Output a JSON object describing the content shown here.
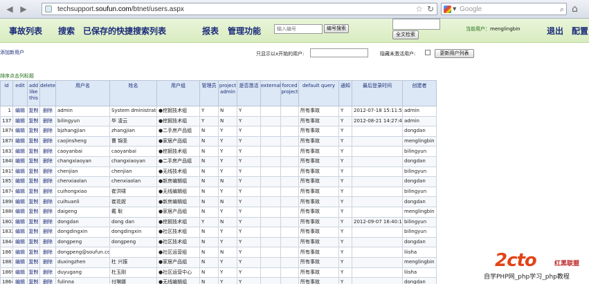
{
  "browser": {
    "url_prefix": "techsupport.",
    "url_host": "soufun.com",
    "url_path": "/btnet/users.aspx",
    "search_placeholder": "Google"
  },
  "header": {
    "menu": [
      "事故列表",
      "搜索",
      "已保存的快捷搜索列表",
      "报表",
      "管理功能"
    ],
    "search_placeholder": "输入编号",
    "search_button": "编号搜索",
    "fulltext_button": "全文检索",
    "current_user_label": "当前用户：",
    "current_user": "menglingbin",
    "logout": "退出",
    "settings": "配置"
  },
  "toolbar": {
    "add_user": "添加新用户",
    "filter_label": "只显示以x开始的用户:",
    "hide_inactive_label": "隐藏未激活用户:",
    "refresh_button": "更新用户列表",
    "sort_hint": "排序点击列标题"
  },
  "table": {
    "headers": [
      "id",
      "edit",
      "add like this",
      "delete",
      "用户名",
      "姓名",
      "用户组",
      "管理员",
      "project admin",
      "是否激活",
      "external",
      "forced project",
      "default query",
      "通知",
      "最后登录时间",
      "创建者"
    ],
    "action_labels": {
      "edit": "编辑",
      "copy": "复制",
      "delete": "删除"
    },
    "rows": [
      {
        "id": "1",
        "username": "admin",
        "name": "System dministrator",
        "group": "●挖掘技术组",
        "admin": "Y",
        "pa": "N",
        "active": "Y",
        "ext": "N",
        "query": "所有事故",
        "notify": "Y",
        "last": "2012-07-18 15:11:54",
        "creator": "admin"
      },
      {
        "id": "137",
        "username": "bilingyun",
        "name": "毕 凌云",
        "group": "●挖掘技术组",
        "admin": "Y",
        "pa": "N",
        "active": "Y",
        "ext": "N",
        "query": "所有事故",
        "notify": "Y",
        "last": "2012-08-21 14:27:45",
        "creator": "admin"
      },
      {
        "id": "1876",
        "username": "bjzhangjian",
        "name": "zhangjian",
        "group": "●二手房产品组",
        "admin": "N",
        "pa": "Y",
        "active": "Y",
        "ext": "N",
        "query": "所有事故",
        "notify": "Y",
        "last": "",
        "creator": "dongdan"
      },
      {
        "id": "1878",
        "username": "caojinsheng",
        "name": "曹 锦圣",
        "group": "●家居产品组",
        "admin": "N",
        "pa": "Y",
        "active": "Y",
        "ext": "N",
        "query": "所有事故",
        "notify": "Y",
        "last": "",
        "creator": "menglingbin"
      },
      {
        "id": "1833",
        "username": "caoyanbai",
        "name": "caoyanbai",
        "group": "●挖掘技术组",
        "admin": "N",
        "pa": "Y",
        "active": "Y",
        "ext": "N",
        "query": "所有事故",
        "notify": "Y",
        "last": "",
        "creator": "bilingyun"
      },
      {
        "id": "1848",
        "username": "changxiaoyan",
        "name": "changxiaoyan",
        "group": "●二手房产品组",
        "admin": "N",
        "pa": "Y",
        "active": "Y",
        "ext": "N",
        "query": "所有事故",
        "notify": "Y",
        "last": "",
        "creator": "dongdan"
      },
      {
        "id": "1815",
        "username": "chenjian",
        "name": "chenjian",
        "group": "●无线技术组",
        "admin": "N",
        "pa": "Y",
        "active": "Y",
        "ext": "N",
        "query": "所有事故",
        "notify": "Y",
        "last": "",
        "creator": "bilingyun"
      },
      {
        "id": "1851",
        "username": "chenxiaolan",
        "name": "chenxiaolan",
        "group": "●新房编辑组",
        "admin": "N",
        "pa": "N",
        "active": "Y",
        "ext": "N",
        "query": "所有事故",
        "notify": "Y",
        "last": "",
        "creator": "dongdan"
      },
      {
        "id": "1874",
        "username": "cuihongxiao",
        "name": "崔洪啸",
        "group": "●无线编辑组",
        "admin": "N",
        "pa": "Y",
        "active": "Y",
        "ext": "N",
        "query": "所有事故",
        "notify": "Y",
        "last": "",
        "creator": "bilingyun"
      },
      {
        "id": "1890",
        "username": "cuihuanli",
        "name": "崔花妮",
        "group": "●新房编辑组",
        "admin": "N",
        "pa": "N",
        "active": "Y",
        "ext": "N",
        "query": "所有事故",
        "notify": "Y",
        "last": "",
        "creator": "dongdan"
      },
      {
        "id": "1880",
        "username": "daigeng",
        "name": "戴 耿",
        "group": "●家居产品组",
        "admin": "N",
        "pa": "Y",
        "active": "Y",
        "ext": "N",
        "query": "所有事故",
        "notify": "Y",
        "last": "",
        "creator": "menglingbin"
      },
      {
        "id": "1802",
        "username": "dongdan",
        "name": "dong dan",
        "group": "●挖掘技术组",
        "admin": "Y",
        "pa": "N",
        "active": "Y",
        "ext": "N",
        "query": "所有事故",
        "notify": "Y",
        "last": "2012-09-07 16:40:12",
        "creator": "bilingyun"
      },
      {
        "id": "1832",
        "username": "dongdingxin",
        "name": "dongdingxin",
        "group": "●社区技术组",
        "admin": "N",
        "pa": "Y",
        "active": "Y",
        "ext": "N",
        "query": "所有事故",
        "notify": "Y",
        "last": "",
        "creator": "bilingyun"
      },
      {
        "id": "1844",
        "username": "dongpeng",
        "name": "dongpeng",
        "group": "●社区技术组",
        "admin": "N",
        "pa": "Y",
        "active": "Y",
        "ext": "N",
        "query": "所有事故",
        "notify": "Y",
        "last": "",
        "creator": "dongdan"
      },
      {
        "id": "1867",
        "username": "dongpeng@soufun.com",
        "name": "",
        "group": "●社区运营组",
        "admin": "N",
        "pa": "N",
        "active": "Y",
        "ext": "N",
        "query": "所有事故",
        "notify": "Y",
        "last": "",
        "creator": "liisha"
      },
      {
        "id": "1883",
        "username": "duxingzhen",
        "name": "杜 兴振",
        "group": "●家居产品组",
        "admin": "N",
        "pa": "Y",
        "active": "Y",
        "ext": "N",
        "query": "所有事故",
        "notify": "Y",
        "last": "",
        "creator": "menglingbin"
      },
      {
        "id": "1869",
        "username": "duyugang",
        "name": "杜玉刚",
        "group": "●社区运营中心",
        "admin": "N",
        "pa": "Y",
        "active": "Y",
        "ext": "N",
        "query": "所有事故",
        "notify": "Y",
        "last": "",
        "creator": "liisha"
      },
      {
        "id": "1864",
        "username": "fulinna",
        "name": "付琳娜",
        "group": "●无线编辑组",
        "admin": "N",
        "pa": "Y",
        "active": "Y",
        "ext": "N",
        "query": "所有事故",
        "notify": "Y",
        "last": "",
        "creator": "dongdan"
      }
    ]
  },
  "watermark": {
    "logo": "2cto",
    "brand": "红黑联盟",
    "footer": "自学PHP网_php学习_php教程"
  }
}
